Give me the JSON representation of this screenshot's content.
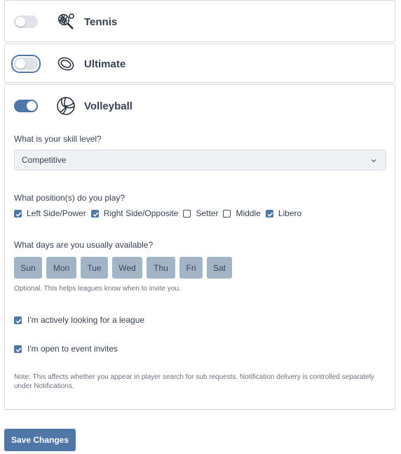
{
  "sports": [
    {
      "name": "Tennis",
      "icon": "tennis-racket-icon",
      "enabled": false
    },
    {
      "name": "Ultimate",
      "icon": "frisbee-icon",
      "enabled": false
    },
    {
      "name": "Volleyball",
      "icon": "volleyball-icon",
      "enabled": true
    }
  ],
  "volleyball": {
    "skill_question": "What is your skill level?",
    "skill_value": "Competitive",
    "position_question": "What position(s) do you play?",
    "positions": [
      {
        "label": "Left Side/Power",
        "checked": true
      },
      {
        "label": "Right Side/Opposite",
        "checked": true
      },
      {
        "label": "Setter",
        "checked": false
      },
      {
        "label": "Middle",
        "checked": false
      },
      {
        "label": "Libero",
        "checked": true
      }
    ],
    "days_question": "What days are you usually available?",
    "days": [
      "Sun",
      "Mon",
      "Tue",
      "Wed",
      "Thu",
      "Fri",
      "Sat"
    ],
    "days_hint": "Optional. This helps leagues know when to invite you.",
    "looking_label": "I'm actively looking for a league",
    "looking_checked": true,
    "invites_label": "I'm open to event invites",
    "invites_checked": true,
    "note": "Note: This affects whether you appear in player search for sub requests. Notification delivery is controlled separately under Notifications."
  },
  "save_label": "Save Changes",
  "colors": {
    "accent": "#4f77a8",
    "day_chip": "#a3b4c7",
    "toggle_off": "#dfe3e8"
  }
}
